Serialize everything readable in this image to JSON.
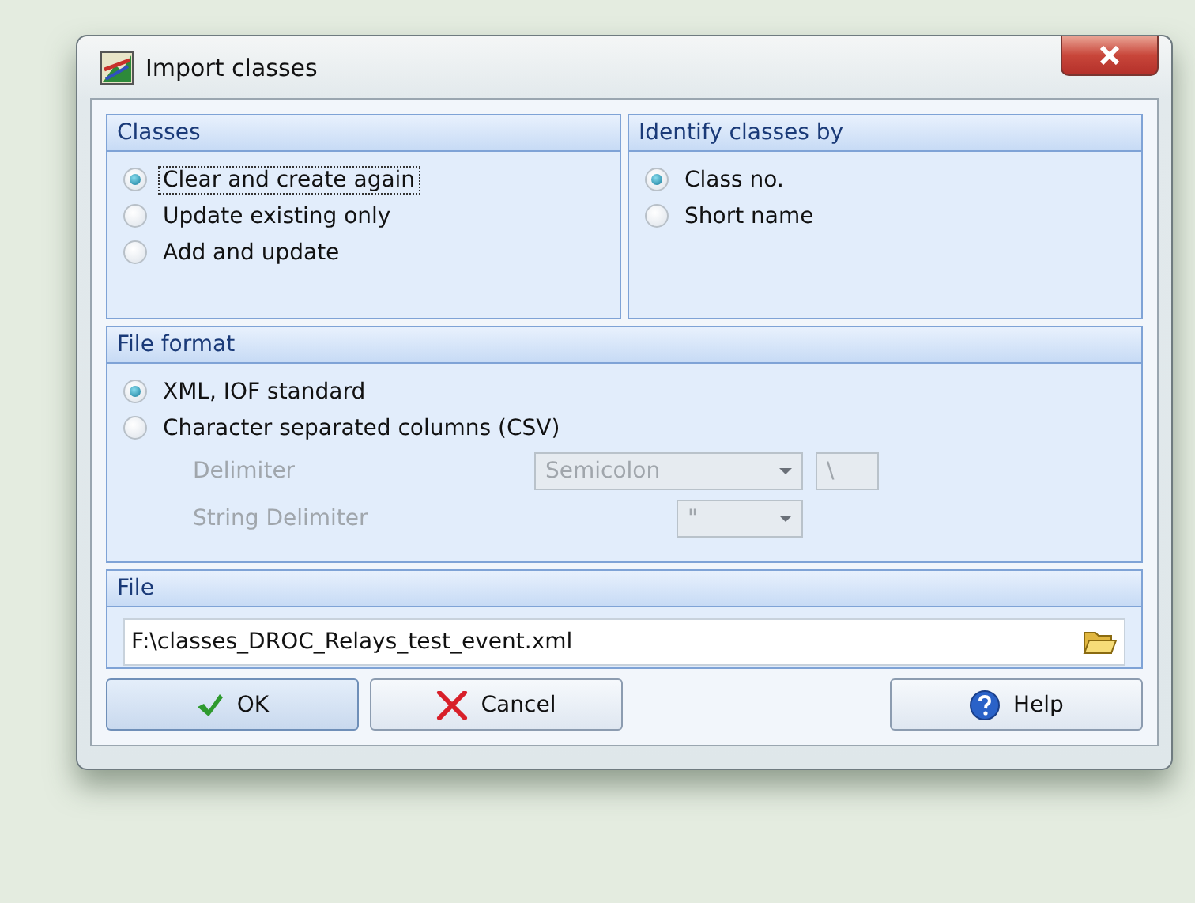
{
  "window": {
    "title": "Import classes"
  },
  "classes": {
    "title": "Classes",
    "options": [
      {
        "label": "Clear and create again",
        "selected": true,
        "focused": true
      },
      {
        "label": "Update existing only",
        "selected": false,
        "focused": false
      },
      {
        "label": "Add and update",
        "selected": false,
        "focused": false
      }
    ]
  },
  "identify_by": {
    "title": "Identify classes by",
    "options": [
      {
        "label": "Class no.",
        "selected": true,
        "focused": false
      },
      {
        "label": "Short name",
        "selected": false,
        "focused": false
      }
    ]
  },
  "file_format": {
    "title": "File format",
    "options": [
      {
        "label": "XML, IOF standard",
        "selected": true,
        "focused": false
      },
      {
        "label": "Character separated columns (CSV)",
        "selected": false,
        "focused": false
      }
    ],
    "delimiter": {
      "label": "Delimiter",
      "value": "Semicolon",
      "extra": "\\",
      "disabled": true
    },
    "string_delimiter": {
      "label": "String Delimiter",
      "value": "\"",
      "disabled": true
    }
  },
  "file": {
    "title": "File",
    "value": "F:\\classes_DROC_Relays_test_event.xml"
  },
  "buttons": [
    {
      "label": "OK",
      "kind": "ok"
    },
    {
      "label": "Cancel",
      "kind": "cancel"
    },
    {
      "label": "Help",
      "kind": "help"
    }
  ]
}
